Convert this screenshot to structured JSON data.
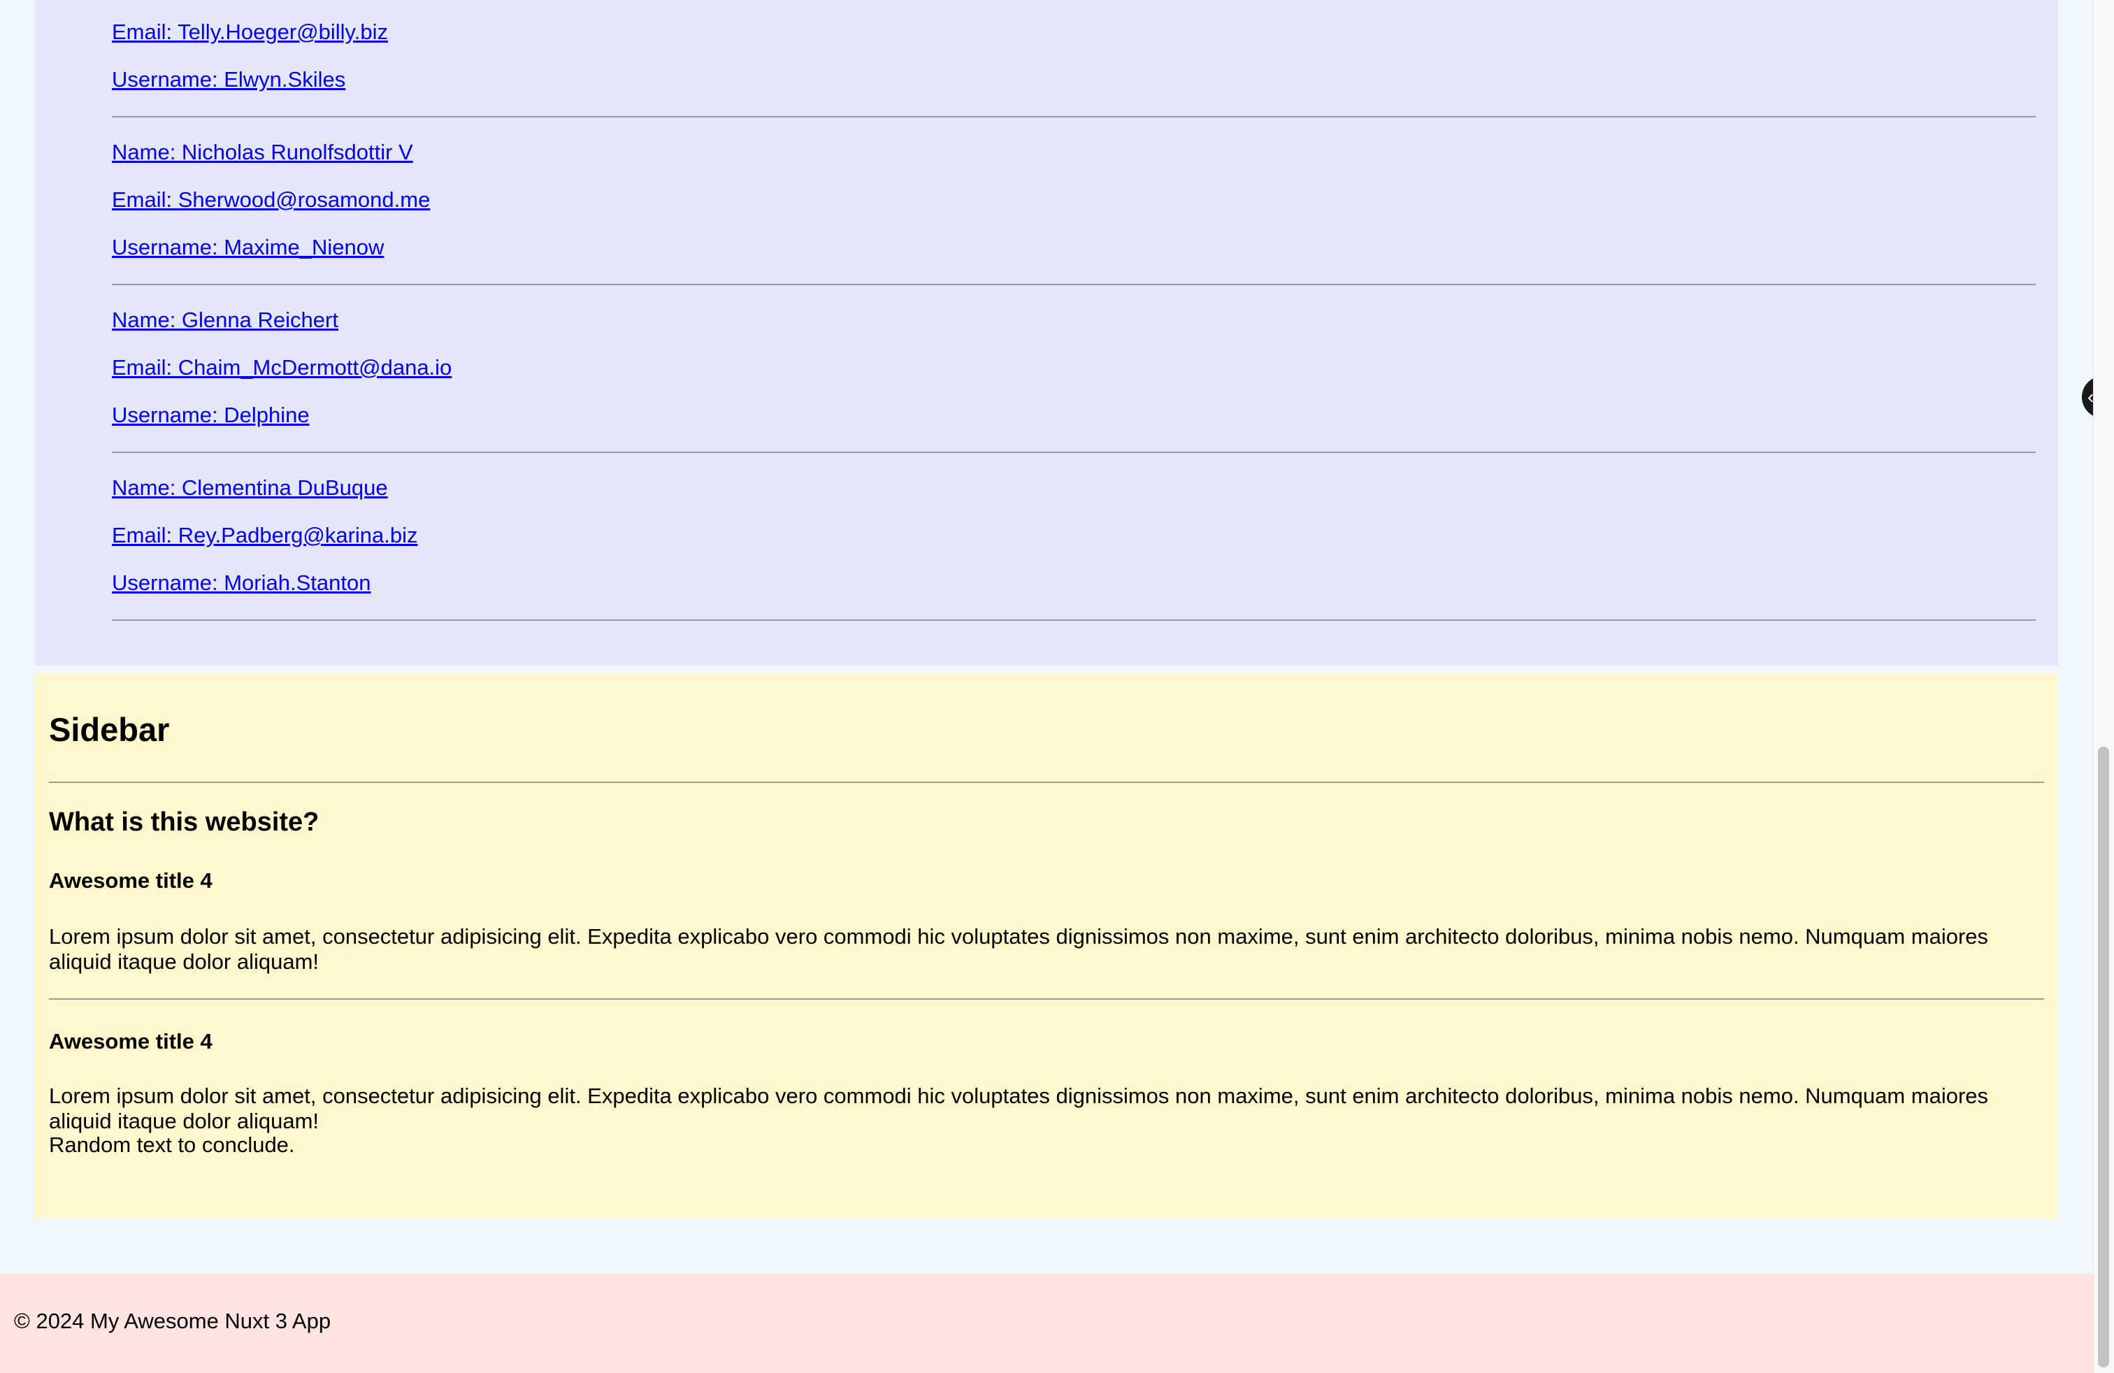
{
  "users": [
    {
      "email": "Email: Telly.Hoeger@billy.biz",
      "username": "Username: Elwyn.Skiles"
    },
    {
      "name": "Name: Nicholas Runolfsdottir V",
      "email": "Email: Sherwood@rosamond.me",
      "username": "Username: Maxime_Nienow"
    },
    {
      "name": "Name: Glenna Reichert",
      "email": "Email: Chaim_McDermott@dana.io",
      "username": "Username: Delphine"
    },
    {
      "name": "Name: Clementina DuBuque",
      "email": "Email: Rey.Padberg@karina.biz",
      "username": "Username: Moriah.Stanton"
    }
  ],
  "sidebar": {
    "title": "Sidebar",
    "question": "What is this website?",
    "items": [
      {
        "title": "Awesome title 4",
        "text": "Lorem ipsum dolor sit amet, consectetur adipisicing elit. Expedita explicabo vero commodi hic voluptates dignissimos non maxime, sunt enim architecto doloribus, minima nobis nemo. Numquam maiores aliquid itaque dolor aliquam!"
      },
      {
        "title": "Awesome title 4",
        "text": "Lorem ipsum dolor sit amet, consectetur adipisicing elit. Expedita explicabo vero commodi hic voluptates dignissimos non maxime, sunt enim architecto doloribus, minima nobis nemo. Numquam maiores aliquid itaque dolor aliquam!"
      }
    ],
    "conclusion": "Random text to conclude."
  },
  "footer": {
    "text": "© 2024 My Awesome Nuxt 3 App"
  },
  "colors": {
    "page_bg": "#f0f8ff",
    "users_panel_bg": "#e6e6fa",
    "sidebar_bg": "#fff8cc",
    "footer_bg": "#ffe4e1",
    "link": "#0000ee"
  },
  "icons": {
    "floating_handle": "chevron-left-icon"
  }
}
